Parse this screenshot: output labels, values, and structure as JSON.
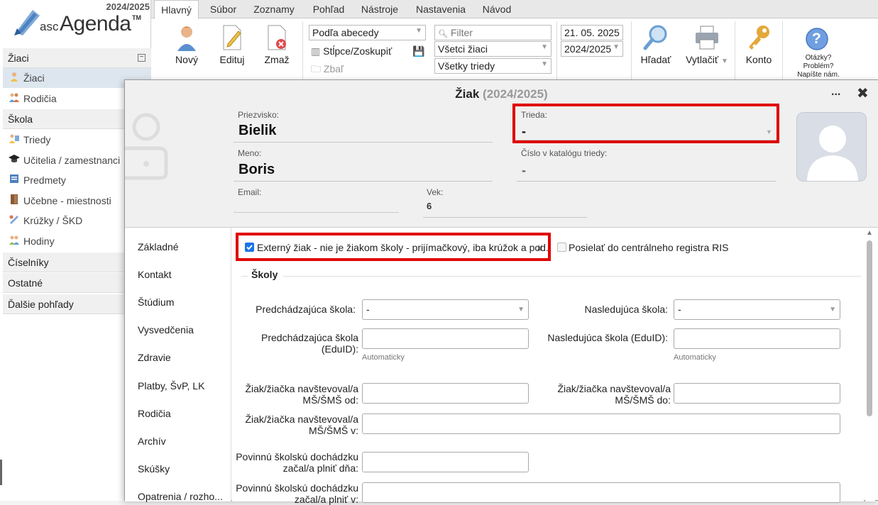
{
  "app": {
    "school_year": "2024/2025",
    "logo_asc": "asc",
    "logo_agenda": "Agenda",
    "logo_tm": "TM"
  },
  "sidebar": {
    "sections": [
      {
        "label": "Žiaci",
        "collapse_glyph": "⊟"
      },
      {
        "label": "Škola"
      },
      {
        "label": "Číselníky"
      },
      {
        "label": "Ostatné"
      },
      {
        "label": "Ďalšie pohľady"
      }
    ],
    "items": [
      {
        "label": "Žiaci",
        "icon": "student-icon",
        "selected": true
      },
      {
        "label": "Rodičia",
        "icon": "parents-icon"
      },
      {
        "label": "Triedy",
        "icon": "classes-icon"
      },
      {
        "label": "Učitelia / zamestnanci",
        "icon": "teacher-cap-icon"
      },
      {
        "label": "Predmety",
        "icon": "subjects-icon"
      },
      {
        "label": "Učebne - miestnosti",
        "icon": "room-door-icon"
      },
      {
        "label": "Krúžky / ŠKD",
        "icon": "clubs-icon"
      },
      {
        "label": "Hodiny",
        "icon": "lessons-icon"
      }
    ]
  },
  "ribbon": {
    "tabs": [
      "Hlavný",
      "Súbor",
      "Zoznamy",
      "Pohľad",
      "Nástroje",
      "Nastavenia",
      "Návod"
    ],
    "active_tab": "Hlavný",
    "new_label": "Nový",
    "edit_label": "Edituj",
    "delete_label": "Zmaž",
    "sort_combo": "Podľa abecedy",
    "columns_label": "Stĺpce/Zoskupiť",
    "collapse_label": "Zbaľ",
    "filter_placeholder": "Filter",
    "filter_students": "Všetci žiaci",
    "filter_classes": "Všetky triedy",
    "date": "21. 05. 2025",
    "year_combo": "2024/2025",
    "search_label": "Hľadať",
    "print_label": "Vytlačiť",
    "print_arrow": "▼",
    "account_label": "Konto",
    "help_glyph": "?",
    "help_line1": "Otázky?",
    "help_line2": "Problém?",
    "help_line3": "Napíšte nám."
  },
  "dialog": {
    "title": "Žiak",
    "title_year": "(2024/2025)",
    "more": "...",
    "close": "✖",
    "surname_label": "Priezvisko:",
    "surname": "Bielik",
    "name_label": "Meno:",
    "name": "Boris",
    "email_label": "Email:",
    "email": "",
    "age_label": "Vek:",
    "age": "6",
    "class_label": "Trieda:",
    "class_value": "-",
    "catalog_label": "Číslo v katalógu triedy:",
    "catalog_value": "-",
    "nav": [
      "Základné",
      "Kontakt",
      "Štúdium",
      "Vysvedčenia",
      "Zdravie",
      "Platby, ŠvP, LK",
      "Rodičia",
      "Archív",
      "Skúšky",
      "Opatrenia / rozho..."
    ],
    "external_checked": true,
    "external_label": "Externý žiak - nie je žiakom školy - prijímačkový, iba krúžok a pod.",
    "external_hash": "#",
    "ris_checked": false,
    "ris_label": "Posielať do centrálneho registra RIS",
    "section_schools": "Školy",
    "prev_school_label": "Predchádzajúca škola:",
    "prev_school_value": "-",
    "next_school_label": "Nasledujúca škola:",
    "next_school_value": "-",
    "prev_eduid_label_1": "Predchádzajúca škola",
    "prev_eduid_label_2": "(EduID):",
    "next_eduid_label": "Nasledujúca škola (EduID):",
    "auto_hint": "Automaticky",
    "ms_from_label_1": "Žiak/žiačka navštevoval/a",
    "ms_from_label_2": "MŠ/ŠMŠ od:",
    "ms_to_label_1": "Žiak/žiačka navštevoval/a",
    "ms_to_label_2": "MŠ/ŠMŠ do:",
    "ms_in_label_1": "Žiak/žiačka navštevoval/a",
    "ms_in_label_2": "MŠ/ŠMŠ v:",
    "compulsory_date_label_1": "Povinnú školskú dochádzku",
    "compulsory_date_label_2": "začal/a plniť dňa:",
    "compulsory_in_label_1": "Povinnú školskú dochádzku",
    "compulsory_in_label_2": "začal/a plniť v:"
  },
  "colors": {
    "highlight_red": "#e00000",
    "checkbox_blue": "#1a73e8",
    "selected_sidebar": "#dde6ee"
  }
}
